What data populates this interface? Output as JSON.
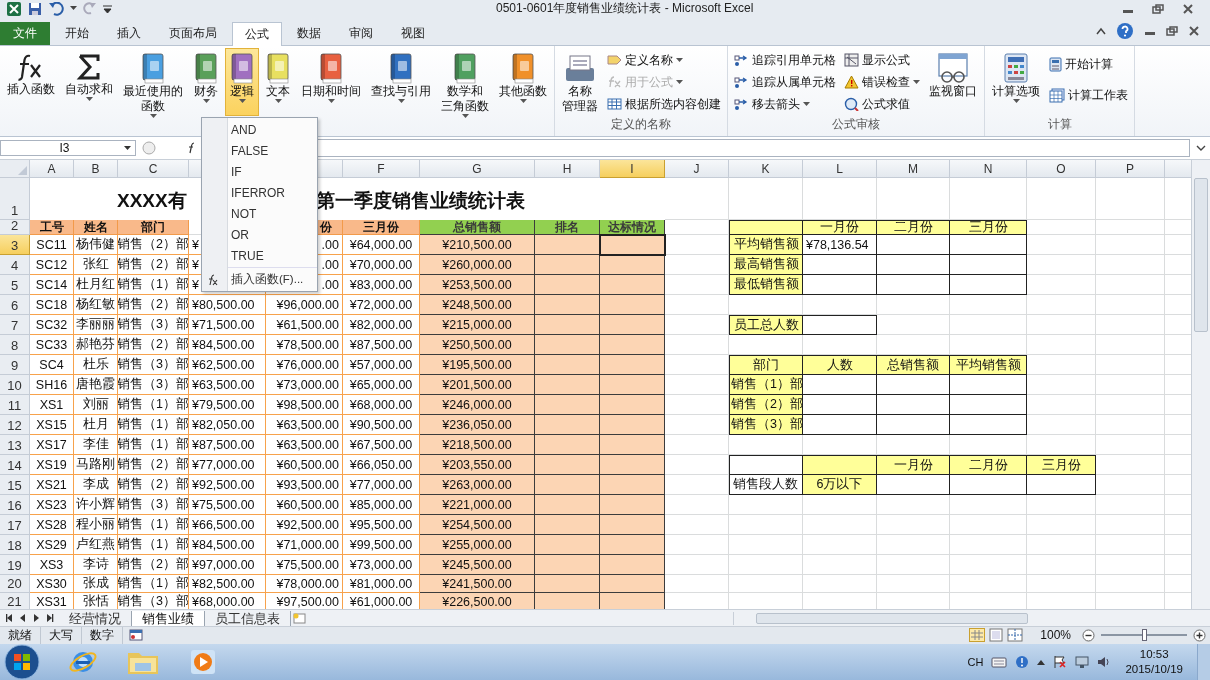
{
  "window": {
    "title": "0501-0601年度销售业绩统计表 - Microsoft Excel"
  },
  "tabs": [
    {
      "label": "文件",
      "kind": "file",
      "selected": false
    },
    {
      "label": "开始",
      "kind": "tab",
      "selected": false
    },
    {
      "label": "插入",
      "kind": "tab",
      "selected": false
    },
    {
      "label": "页面布局",
      "kind": "tab",
      "selected": false
    },
    {
      "label": "公式",
      "kind": "tab",
      "selected": true
    },
    {
      "label": "数据",
      "kind": "tab",
      "selected": false
    },
    {
      "label": "审阅",
      "kind": "tab",
      "selected": false
    },
    {
      "label": "视图",
      "kind": "tab",
      "selected": false
    }
  ],
  "ribbon": {
    "groups": [
      {
        "items": [
          {
            "kind": "large",
            "lines": [
              "插入函数"
            ],
            "dropdown": false,
            "expanded": false,
            "disabled": false
          },
          {
            "kind": "large",
            "lines": [
              "自动求和"
            ],
            "dropdown": true,
            "expanded": false,
            "disabled": false
          },
          {
            "kind": "large",
            "lines": [
              "最近使用的",
              "函数"
            ],
            "dropdown": true,
            "expanded": false,
            "disabled": false
          },
          {
            "kind": "large",
            "lines": [
              "财务"
            ],
            "dropdown": true,
            "expanded": false,
            "disabled": false
          },
          {
            "kind": "large",
            "lines": [
              "逻辑"
            ],
            "dropdown": true,
            "expanded": true,
            "disabled": false
          },
          {
            "kind": "large",
            "lines": [
              "文本"
            ],
            "dropdown": true,
            "expanded": false,
            "disabled": false
          },
          {
            "kind": "large",
            "lines": [
              "日期和时间"
            ],
            "dropdown": true,
            "expanded": false,
            "disabled": false
          },
          {
            "kind": "large",
            "lines": [
              "查找与引用"
            ],
            "dropdown": true,
            "expanded": false,
            "disabled": false
          },
          {
            "kind": "large",
            "lines": [
              "数学和",
              "三角函数"
            ],
            "dropdown": true,
            "expanded": false,
            "disabled": false
          },
          {
            "kind": "large",
            "lines": [
              "其他函数"
            ],
            "dropdown": true,
            "expanded": false,
            "disabled": false
          }
        ]
      },
      {
        "label": "定义的名称",
        "items": [
          {
            "kind": "large",
            "lines": [
              "名称",
              "管理器"
            ],
            "dropdown": false,
            "expanded": false,
            "disabled": false
          },
          {
            "kind": "small",
            "lines": [
              "定义名称"
            ],
            "dropdown": true,
            "expanded": false,
            "disabled": false
          },
          {
            "kind": "small",
            "lines": [
              "用于公式"
            ],
            "dropdown": true,
            "expanded": false,
            "disabled": true
          },
          {
            "kind": "small",
            "lines": [
              "根据所选内容创建"
            ],
            "dropdown": false,
            "expanded": false,
            "disabled": false
          }
        ]
      },
      {
        "label": "公式审核",
        "items": [
          {
            "kind": "small",
            "lines": [
              "追踪引用单元格"
            ],
            "dropdown": false,
            "expanded": false,
            "disabled": false
          },
          {
            "kind": "small",
            "lines": [
              "追踪从属单元格"
            ],
            "dropdown": false,
            "expanded": false,
            "disabled": false
          },
          {
            "kind": "small",
            "lines": [
              "移去箭头"
            ],
            "dropdown": true,
            "expanded": false,
            "disabled": false
          },
          {
            "kind": "small",
            "lines": [
              "显示公式"
            ],
            "dropdown": false,
            "expanded": false,
            "disabled": false
          },
          {
            "kind": "small",
            "lines": [
              "错误检查"
            ],
            "dropdown": true,
            "expanded": false,
            "disabled": false
          },
          {
            "kind": "small",
            "lines": [
              "公式求值"
            ],
            "dropdown": false,
            "expanded": false,
            "disabled": false
          },
          {
            "kind": "large",
            "lines": [
              "监视窗口"
            ],
            "dropdown": false,
            "expanded": false,
            "disabled": false
          }
        ]
      },
      {
        "label": "计算",
        "items": [
          {
            "kind": "large",
            "lines": [
              "计算选项"
            ],
            "dropdown": true,
            "expanded": false,
            "disabled": false
          },
          {
            "kind": "small",
            "lines": [
              "开始计算"
            ],
            "dropdown": false,
            "expanded": false,
            "disabled": false
          },
          {
            "kind": "small",
            "lines": [
              "计算工作表"
            ],
            "dropdown": false,
            "expanded": false,
            "disabled": false
          }
        ]
      }
    ]
  },
  "menu": {
    "items": [
      {
        "label": "AND"
      },
      {
        "label": "FALSE"
      },
      {
        "label": "IF"
      },
      {
        "label": "IFERROR"
      },
      {
        "label": "NOT"
      },
      {
        "label": "OR"
      },
      {
        "label": "TRUE"
      }
    ],
    "footer": {
      "label": "插入函数(F)..."
    }
  },
  "formula_bar": {
    "name_box": "I3"
  },
  "sheet": {
    "columns": [
      {
        "label": "A",
        "selected": false
      },
      {
        "label": "B",
        "selected": false
      },
      {
        "label": "C",
        "selected": false
      },
      {
        "selected": false
      },
      {
        "selected": false
      },
      {
        "label": "F",
        "selected": false
      },
      {
        "label": "G",
        "selected": false
      },
      {
        "label": "H",
        "selected": false
      },
      {
        "label": "I",
        "selected": true
      },
      {
        "label": "J",
        "selected": false
      },
      {
        "label": "K",
        "selected": false
      },
      {
        "label": "L",
        "selected": false
      },
      {
        "label": "M",
        "selected": false
      },
      {
        "label": "N",
        "selected": false
      },
      {
        "label": "O",
        "selected": false
      },
      {
        "label": "P",
        "selected": false
      }
    ],
    "rows": [
      {
        "label": "1",
        "selected": false
      },
      {
        "label": "2",
        "selected": false
      },
      {
        "label": "3",
        "selected": true
      },
      {
        "label": "4",
        "selected": false
      },
      {
        "label": "5",
        "selected": false
      },
      {
        "label": "6",
        "selected": false
      },
      {
        "label": "7",
        "selected": false
      },
      {
        "label": "8",
        "selected": false
      },
      {
        "label": "9",
        "selected": false
      },
      {
        "label": "10",
        "selected": false
      },
      {
        "label": "11",
        "selected": false
      },
      {
        "label": "12",
        "selected": false
      },
      {
        "label": "13",
        "selected": false
      },
      {
        "label": "14",
        "selected": false
      },
      {
        "label": "15",
        "selected": false
      },
      {
        "label": "16",
        "selected": false
      },
      {
        "label": "17",
        "selected": false
      },
      {
        "label": "18",
        "selected": false
      },
      {
        "label": "19",
        "selected": false
      },
      {
        "label": "20",
        "selected": false
      },
      {
        "label": "21",
        "selected": false
      }
    ],
    "title_parts": [
      "XXXX有",
      "第一季度销售业绩统计表"
    ],
    "header": [
      {
        "text": "工号",
        "kind": "info"
      },
      {
        "text": "姓名",
        "kind": "info"
      },
      {
        "text": "部门",
        "kind": "info"
      },
      {
        "text": "份",
        "kind": "info"
      },
      {
        "text": "三月份",
        "kind": "info"
      },
      {
        "text": "总销售额",
        "kind": "result"
      },
      {
        "text": "排名",
        "kind": "result"
      },
      {
        "text": "达标情况",
        "kind": "result"
      }
    ],
    "records": [
      [
        "SC11",
        "杨伟健",
        "销售（2）部",
        "¥",
        ".00",
        "¥64,000.00",
        "¥210,500.00"
      ],
      [
        "SC12",
        "张红",
        "销售（2）部",
        "¥",
        ".00",
        "¥70,000.00",
        "¥260,000.00"
      ],
      [
        "SC14",
        "杜月红",
        "销售（1）部",
        "¥",
        ".00",
        "¥83,000.00",
        "¥253,500.00"
      ],
      [
        "SC18",
        "杨红敏",
        "销售（2）部",
        "¥80,500.00",
        "¥96,000.00",
        "¥72,000.00",
        "¥248,500.00"
      ],
      [
        "SC32",
        "李丽丽",
        "销售（3）部",
        "¥71,500.00",
        "¥61,500.00",
        "¥82,000.00",
        "¥215,000.00"
      ],
      [
        "SC33",
        "郝艳芬",
        "销售（2）部",
        "¥84,500.00",
        "¥78,500.00",
        "¥87,500.00",
        "¥250,500.00"
      ],
      [
        "SC4",
        "杜乐",
        "销售（3）部",
        "¥62,500.00",
        "¥76,000.00",
        "¥57,000.00",
        "¥195,500.00"
      ],
      [
        "SH16",
        "唐艳霞",
        "销售（3）部",
        "¥63,500.00",
        "¥73,000.00",
        "¥65,000.00",
        "¥201,500.00"
      ],
      [
        "XS1",
        "刘丽",
        "销售（1）部",
        "¥79,500.00",
        "¥98,500.00",
        "¥68,000.00",
        "¥246,000.00"
      ],
      [
        "XS15",
        "杜月",
        "销售（1）部",
        "¥82,050.00",
        "¥63,500.00",
        "¥90,500.00",
        "¥236,050.00"
      ],
      [
        "XS17",
        "李佳",
        "销售（1）部",
        "¥87,500.00",
        "¥63,500.00",
        "¥67,500.00",
        "¥218,500.00"
      ],
      [
        "XS19",
        "马路刚",
        "销售（2）部",
        "¥77,000.00",
        "¥60,500.00",
        "¥66,050.00",
        "¥203,550.00"
      ],
      [
        "XS21",
        "李成",
        "销售（2）部",
        "¥92,500.00",
        "¥93,500.00",
        "¥77,000.00",
        "¥263,000.00"
      ],
      [
        "XS23",
        "许小辉",
        "销售（3）部",
        "¥75,500.00",
        "¥60,500.00",
        "¥85,000.00",
        "¥221,000.00"
      ],
      [
        "XS28",
        "程小丽",
        "销售（1）部",
        "¥66,500.00",
        "¥92,500.00",
        "¥95,500.00",
        "¥254,500.00"
      ],
      [
        "XS29",
        "卢红燕",
        "销售（1）部",
        "¥84,500.00",
        "¥71,000.00",
        "¥99,500.00",
        "¥255,000.00"
      ],
      [
        "XS3",
        "李诗",
        "销售（2）部",
        "¥97,000.00",
        "¥75,500.00",
        "¥73,000.00",
        "¥245,500.00"
      ],
      [
        "XS30",
        "张成",
        "销售（1）部",
        "¥82,500.00",
        "¥78,000.00",
        "¥81,000.00",
        "¥241,500.00"
      ],
      [
        "XS31",
        "张恬",
        "销售（3）部",
        "¥68,000.00",
        "¥97,500.00",
        "¥61,000.00",
        "¥226,500.00"
      ]
    ],
    "side_tables": [
      {
        "rows": [
          [
            {
              "kind": "head"
            },
            {
              "kind": "head",
              "text": "一月份"
            },
            {
              "kind": "head",
              "text": "二月份"
            },
            {
              "kind": "head",
              "text": "三月份"
            }
          ],
          [
            {
              "kind": "head",
              "text": "平均销售额"
            },
            {
              "kind": "data",
              "text": "¥78,136.54"
            },
            {
              "kind": "data"
            },
            {
              "kind": "data"
            }
          ],
          [
            {
              "kind": "head",
              "text": "最高销售额"
            },
            {
              "kind": "data"
            },
            {
              "kind": "data"
            },
            {
              "kind": "data"
            }
          ],
          [
            {
              "kind": "head",
              "text": "最低销售额"
            },
            {
              "kind": "data"
            },
            {
              "kind": "data"
            },
            {
              "kind": "data"
            }
          ]
        ]
      },
      {
        "rows": [
          [
            {
              "kind": "head",
              "text": "员工总人数"
            },
            {
              "kind": "data"
            }
          ]
        ]
      },
      {
        "rows": [
          [
            {
              "kind": "head",
              "text": "部门"
            },
            {
              "kind": "head",
              "text": "人数"
            },
            {
              "kind": "head",
              "text": "总销售额"
            },
            {
              "kind": "head",
              "text": "平均销售额"
            }
          ],
          [
            {
              "kind": "head",
              "text": "销售（1）部"
            },
            {
              "kind": "data"
            },
            {
              "kind": "data"
            },
            {
              "kind": "data"
            }
          ],
          [
            {
              "kind": "head",
              "text": "销售（2）部"
            },
            {
              "kind": "data"
            },
            {
              "kind": "data"
            },
            {
              "kind": "data"
            }
          ],
          [
            {
              "kind": "head",
              "text": "销售（3）部"
            },
            {
              "kind": "data"
            },
            {
              "kind": "data"
            },
            {
              "kind": "data"
            }
          ]
        ]
      },
      {
        "rows": [
          [
            {
              "kind": "data"
            },
            {
              "kind": "head"
            },
            {
              "kind": "head",
              "text": "一月份"
            },
            {
              "kind": "head",
              "text": "二月份"
            },
            {
              "kind": "head",
              "text": "三月份"
            }
          ],
          [
            {
              "kind": "data",
              "text": "销售段人数"
            },
            {
              "kind": "head",
              "text": "6万以下"
            },
            {
              "kind": "data"
            },
            {
              "kind": "data"
            },
            {
              "kind": "data"
            }
          ]
        ]
      }
    ]
  },
  "sheet_tabs": [
    {
      "label": "经营情况",
      "selected": false
    },
    {
      "label": "销售业绩",
      "selected": true
    },
    {
      "label": "员工信息表",
      "selected": false
    }
  ],
  "status_bar": {
    "items": [
      "就绪",
      "大写",
      "数字"
    ],
    "zoom": {
      "label": "100%",
      "level": 0.5
    }
  },
  "taskbar": {
    "language": "CH",
    "time": "10:53",
    "date": "2015/10/19"
  }
}
